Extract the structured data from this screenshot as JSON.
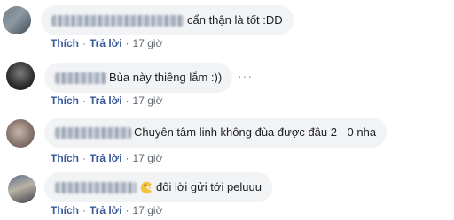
{
  "comments": [
    {
      "text": "cẩn thận là tốt :DD",
      "actions": {
        "like": "Thích",
        "reply": "Trả lời",
        "time": "17 giờ"
      }
    },
    {
      "text": "Bùa này thiêng lắm :))",
      "more_menu": "···",
      "actions": {
        "like": "Thích",
        "reply": "Trả lời",
        "time": "17 giờ"
      }
    },
    {
      "text": "Chuyên tâm linh không đùa được đâu 2 - 0 nha",
      "actions": {
        "like": "Thích",
        "reply": "Trả lời",
        "time": "17 giờ"
      }
    },
    {
      "text": "đôi lời gửi tới peluuu",
      "emoji": "pacman-emoji",
      "actions": {
        "like": "Thích",
        "reply": "Trả lời",
        "time": "17 giờ"
      }
    }
  ],
  "separator": "·",
  "colors": {
    "link": "#385898",
    "meta": "#606770",
    "bubble": "#f2f3f5"
  }
}
